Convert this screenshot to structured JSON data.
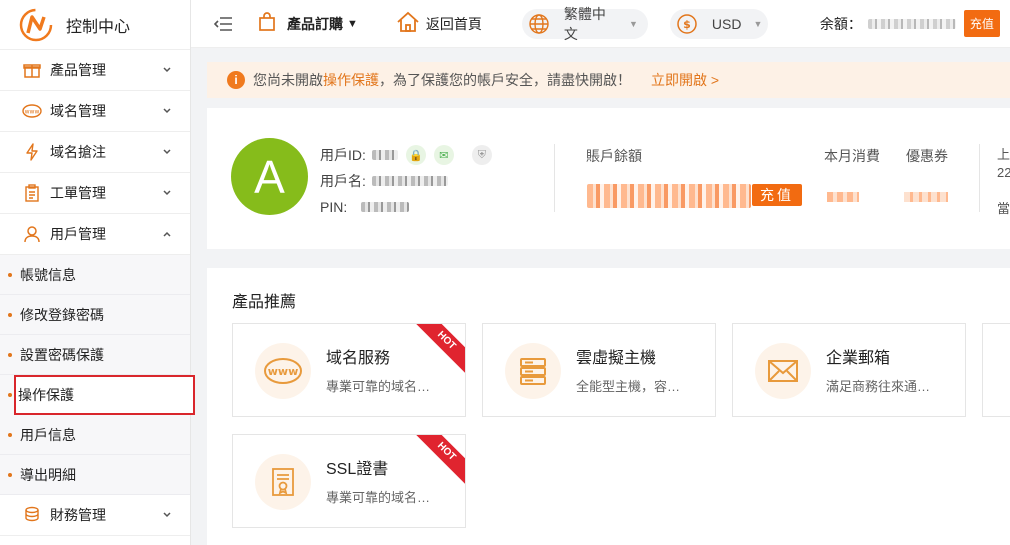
{
  "app": {
    "title": "控制中心"
  },
  "sidebar": {
    "items": [
      {
        "label": "產品管理",
        "icon": "gift-icon",
        "chevron": "down"
      },
      {
        "label": "域名管理",
        "icon": "www-icon",
        "chevron": "down"
      },
      {
        "label": "域名搶注",
        "icon": "lightning-icon",
        "chevron": "down"
      },
      {
        "label": "工單管理",
        "icon": "clipboard-icon",
        "chevron": "down"
      },
      {
        "label": "用戶管理",
        "icon": "user-icon",
        "chevron": "up"
      }
    ],
    "sub_items": [
      {
        "label": "帳號信息"
      },
      {
        "label": "修改登錄密碼"
      },
      {
        "label": "設置密碼保護"
      },
      {
        "label": "操作保護",
        "active": true
      },
      {
        "label": "用戶信息"
      },
      {
        "label": "導出明細"
      }
    ],
    "finance": {
      "label": "財務管理",
      "icon": "coins-icon"
    }
  },
  "topbar": {
    "product_order": "產品訂購",
    "home": "返回首頁",
    "language": "繁體中文",
    "currency": "USD",
    "balance_label": "余額：",
    "recharge": "充值"
  },
  "notice": {
    "prefix": "您尚未開啟",
    "highlight": "操作保護",
    "suffix": "，為了保護您的帳戶安全，請盡快開啟！",
    "link": "立即開啟 >"
  },
  "account": {
    "avatar_letter": "A",
    "user_id_label": "用戶ID:",
    "username_label": "用戶名:",
    "pin_label": "PIN:",
    "balance_label": "賬戶餘額",
    "recharge": "充值",
    "monthly_label": "本月消費",
    "coupon_label": "優惠券",
    "edge_1": "上",
    "edge_2": "22",
    "edge_3": "當"
  },
  "products": {
    "title": "產品推薦",
    "cards": [
      {
        "name": "域名服務",
        "desc": "專業可靠的域名…",
        "icon": "www-icon",
        "hot": true
      },
      {
        "name": "雲虛擬主機",
        "desc": "全能型主機，容…",
        "icon": "server-icon",
        "hot": false
      },
      {
        "name": "企業郵箱",
        "desc": "滿足商務往來通…",
        "icon": "envelope-icon",
        "hot": false
      },
      {
        "name": "SSL證書",
        "desc": "專業可靠的域名…",
        "icon": "certificate-icon",
        "hot": true
      }
    ],
    "hot_label": "HOT"
  },
  "colors": {
    "accent": "#f26b11",
    "avatar": "#86bc1b",
    "hot": "#e0242f"
  }
}
